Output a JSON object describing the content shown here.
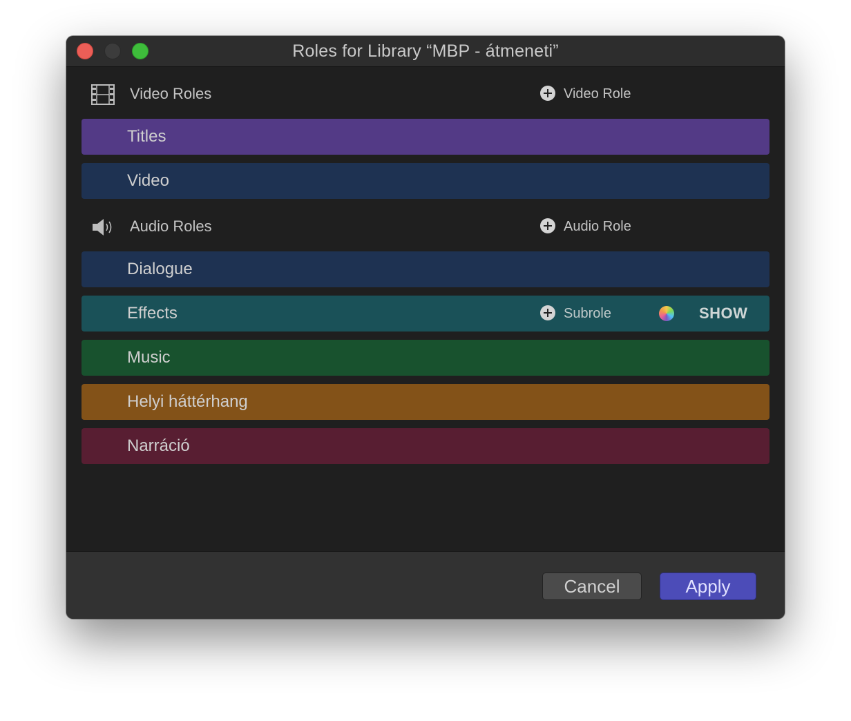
{
  "window": {
    "title": "Roles for Library “MBP - átmeneti”"
  },
  "video_section": {
    "label": "Video Roles",
    "icon": "film-strip-icon",
    "add_label": "Video Role",
    "roles": [
      {
        "label": "Titles",
        "color": "#533a86"
      },
      {
        "label": "Video",
        "color": "#1e3252"
      }
    ]
  },
  "audio_section": {
    "label": "Audio Roles",
    "icon": "speaker-icon",
    "add_label": "Audio Role",
    "roles": [
      {
        "label": "Dialogue",
        "color": "#1e3252"
      },
      {
        "label": "Effects",
        "color": "#1a5158",
        "subrole_label": "Subrole",
        "show_label": "SHOW"
      },
      {
        "label": "Music",
        "color": "#18522e"
      },
      {
        "label": "Helyi háttérhang",
        "color": "#835218"
      },
      {
        "label": "Narráció",
        "color": "#581e32"
      }
    ]
  },
  "footer": {
    "cancel_label": "Cancel",
    "apply_label": "Apply"
  }
}
